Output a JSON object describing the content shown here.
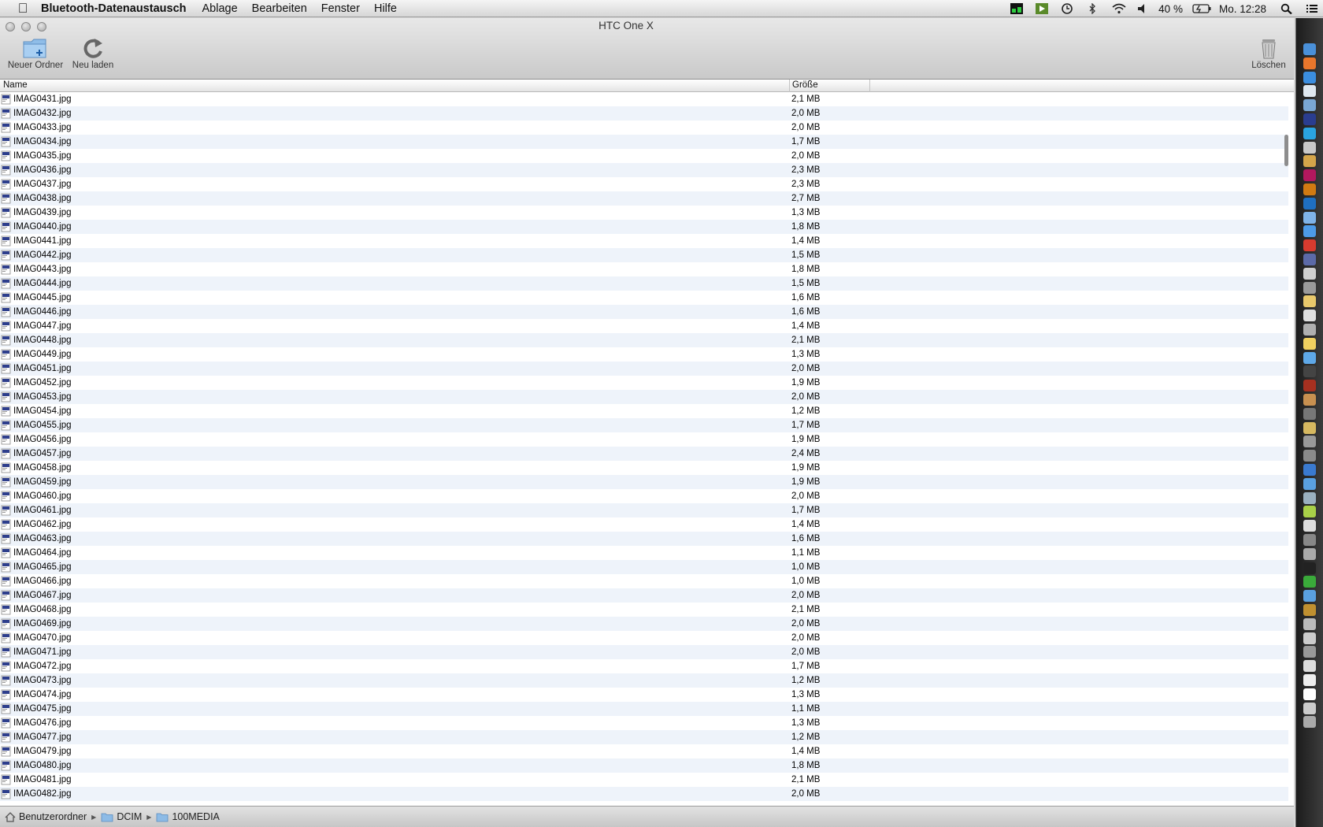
{
  "menubar": {
    "app_name": "Bluetooth-Datenaustausch",
    "menus": [
      "Ablage",
      "Bearbeiten",
      "Fenster",
      "Hilfe"
    ],
    "battery": "40 %",
    "clock": "Mo. 12:28"
  },
  "window": {
    "title": "HTC One X",
    "toolbar": {
      "new_folder": "Neuer Ordner",
      "reload": "Neu laden",
      "delete": "Löschen"
    },
    "columns": {
      "name": "Name",
      "size": "Größe"
    }
  },
  "files": [
    {
      "name": "IMAG0431.jpg",
      "size": "2,1 MB"
    },
    {
      "name": "IMAG0432.jpg",
      "size": "2,0 MB"
    },
    {
      "name": "IMAG0433.jpg",
      "size": "2,0 MB"
    },
    {
      "name": "IMAG0434.jpg",
      "size": "1,7 MB"
    },
    {
      "name": "IMAG0435.jpg",
      "size": "2,0 MB"
    },
    {
      "name": "IMAG0436.jpg",
      "size": "2,3 MB"
    },
    {
      "name": "IMAG0437.jpg",
      "size": "2,3 MB"
    },
    {
      "name": "IMAG0438.jpg",
      "size": "2,7 MB"
    },
    {
      "name": "IMAG0439.jpg",
      "size": "1,3 MB"
    },
    {
      "name": "IMAG0440.jpg",
      "size": "1,8 MB"
    },
    {
      "name": "IMAG0441.jpg",
      "size": "1,4 MB"
    },
    {
      "name": "IMAG0442.jpg",
      "size": "1,5 MB"
    },
    {
      "name": "IMAG0443.jpg",
      "size": "1,8 MB"
    },
    {
      "name": "IMAG0444.jpg",
      "size": "1,5 MB"
    },
    {
      "name": "IMAG0445.jpg",
      "size": "1,6 MB"
    },
    {
      "name": "IMAG0446.jpg",
      "size": "1,6 MB"
    },
    {
      "name": "IMAG0447.jpg",
      "size": "1,4 MB"
    },
    {
      "name": "IMAG0448.jpg",
      "size": "2,1 MB"
    },
    {
      "name": "IMAG0449.jpg",
      "size": "1,3 MB"
    },
    {
      "name": "IMAG0451.jpg",
      "size": "2,0 MB"
    },
    {
      "name": "IMAG0452.jpg",
      "size": "1,9 MB"
    },
    {
      "name": "IMAG0453.jpg",
      "size": "2,0 MB"
    },
    {
      "name": "IMAG0454.jpg",
      "size": "1,2 MB"
    },
    {
      "name": "IMAG0455.jpg",
      "size": "1,7 MB"
    },
    {
      "name": "IMAG0456.jpg",
      "size": "1,9 MB"
    },
    {
      "name": "IMAG0457.jpg",
      "size": "2,4 MB"
    },
    {
      "name": "IMAG0458.jpg",
      "size": "1,9 MB"
    },
    {
      "name": "IMAG0459.jpg",
      "size": "1,9 MB"
    },
    {
      "name": "IMAG0460.jpg",
      "size": "2,0 MB"
    },
    {
      "name": "IMAG0461.jpg",
      "size": "1,7 MB"
    },
    {
      "name": "IMAG0462.jpg",
      "size": "1,4 MB"
    },
    {
      "name": "IMAG0463.jpg",
      "size": "1,6 MB"
    },
    {
      "name": "IMAG0464.jpg",
      "size": "1,1 MB"
    },
    {
      "name": "IMAG0465.jpg",
      "size": "1,0 MB"
    },
    {
      "name": "IMAG0466.jpg",
      "size": "1,0 MB"
    },
    {
      "name": "IMAG0467.jpg",
      "size": "2,0 MB"
    },
    {
      "name": "IMAG0468.jpg",
      "size": "2,1 MB"
    },
    {
      "name": "IMAG0469.jpg",
      "size": "2,0 MB"
    },
    {
      "name": "IMAG0470.jpg",
      "size": "2,0 MB"
    },
    {
      "name": "IMAG0471.jpg",
      "size": "2,0 MB"
    },
    {
      "name": "IMAG0472.jpg",
      "size": "1,7 MB"
    },
    {
      "name": "IMAG0473.jpg",
      "size": "1,2 MB"
    },
    {
      "name": "IMAG0474.jpg",
      "size": "1,3 MB"
    },
    {
      "name": "IMAG0475.jpg",
      "size": "1,1 MB"
    },
    {
      "name": "IMAG0476.jpg",
      "size": "1,3 MB"
    },
    {
      "name": "IMAG0477.jpg",
      "size": "1,2 MB"
    },
    {
      "name": "IMAG0479.jpg",
      "size": "1,4 MB"
    },
    {
      "name": "IMAG0480.jpg",
      "size": "1,8 MB"
    },
    {
      "name": "IMAG0481.jpg",
      "size": "2,1 MB"
    },
    {
      "name": "IMAG0482.jpg",
      "size": "2,0 MB"
    }
  ],
  "pathbar": [
    "Benutzerordner",
    "DCIM",
    "100MEDIA"
  ],
  "dock_icons": [
    "finder-icon",
    "firefox-icon",
    "safari-icon",
    "dropbox-icon",
    "preview-icon",
    "app-icon",
    "skype-icon",
    "chrome-icon",
    "stamp-icon",
    "indesign-icon",
    "illustrator-icon",
    "photoshop-icon",
    "itunes-icon",
    "mail-icon",
    "pdf-icon",
    "app-icon",
    "app-icon",
    "app-icon",
    "notes-icon",
    "calendar-icon",
    "app-icon",
    "notes-icon",
    "messages-icon",
    "camera-icon",
    "photobooth-icon",
    "iphoto-icon",
    "app-icon",
    "app-icon",
    "app-icon",
    "app-icon",
    "app-icon",
    "app-icon",
    "app-icon",
    "app-icon",
    "app-icon",
    "app-icon",
    "app-icon",
    "terminal-icon",
    "app-icon",
    "app-icon",
    "app-icon",
    "app-icon",
    "app-icon",
    "app-icon",
    "app-icon",
    "app-icon",
    "app-icon",
    "app-icon",
    "trash-icon"
  ]
}
